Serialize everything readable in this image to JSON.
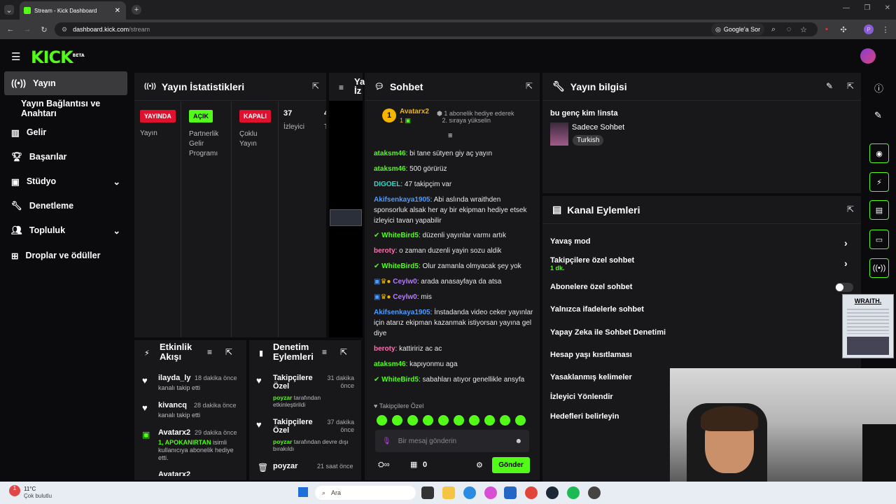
{
  "browser": {
    "tab_title": "Stream - Kick Dashboard",
    "url_domain": "dashboard.kick.com",
    "url_path": "/stream",
    "google_lens": "Google'a Sor"
  },
  "header": {
    "logo": "KICK",
    "logo_beta": "BETA"
  },
  "sidebar": {
    "items": [
      {
        "label": "Yayın",
        "icon": "broadcast-icon"
      },
      {
        "label": "Yayın Bağlantısı ve Anahtarı"
      },
      {
        "label": "Gelir",
        "icon": "chart-icon"
      },
      {
        "label": "Başarılar",
        "icon": "trophy-icon"
      },
      {
        "label": "Stüdyo",
        "icon": "studio-icon"
      },
      {
        "label": "Denetleme",
        "icon": "wrench-icon"
      },
      {
        "label": "Topluluk",
        "icon": "community-icon"
      },
      {
        "label": "Droplar ve ödüller",
        "icon": "drops-icon"
      }
    ]
  },
  "stats": {
    "title": "Yayın İstatistikleri",
    "cols": [
      {
        "badge": "YAYINDA",
        "label": "Yayın"
      },
      {
        "badge": "AÇIK",
        "label": "Partnerlik Gelir Programı"
      },
      {
        "badge": "KAPALI",
        "label": "Çoklu Yayın"
      },
      {
        "value": "37",
        "label": "İzleyici"
      },
      {
        "value": "4",
        "label": "T"
      }
    ]
  },
  "preview": {
    "title_a": "Ya",
    "title_b": "İz"
  },
  "chat": {
    "title": "Sohbet",
    "top_user": "Avatarx2",
    "top_rank": "1",
    "top_count": "1",
    "gift_line1": "1 abonelik hediye ederek",
    "gift_line2": "2. sıraya yükselin",
    "messages": [
      {
        "user": "ataksm46",
        "text": "bi tane sütyen giy aç yayın"
      },
      {
        "user": "ataksm46",
        "text": "500 görürüz"
      },
      {
        "user": "DIGOEL",
        "text": "47 takipçim var"
      },
      {
        "user": "Akifsenkaya1905",
        "text": "Abi aslında wraithden sponsorluk alsak her ay bir ekipman hediye etsek izleyici tavan yapabilir"
      },
      {
        "user": "WhiteBird5",
        "text": "düzenli yayınlar varmı artık"
      },
      {
        "user": "beroty",
        "text": "o zaman duzenli yayin sozu aldik"
      },
      {
        "user": "WhiteBird5",
        "text": "Olur zamanla olmyacak şey yok"
      },
      {
        "user": "Ceylw0",
        "text": "arada anasayfaya da atsa"
      },
      {
        "user": "Ceylw0",
        "text": "mis"
      },
      {
        "user": "Akifsenkaya1905",
        "text": "İnstadanda video ceker yayınlar için atarız ekipman kazanmak istiyorsan yayına gel diye"
      },
      {
        "user": "beroty",
        "text": "kattiririz ac ac"
      },
      {
        "user": "ataksm46",
        "text": "kapıyonmu aga"
      },
      {
        "user": "WhiteBird5",
        "text": "sabahları atıyor genellikle ansyfa"
      }
    ],
    "emote_label": "Takipçilere Özel",
    "input_placeholder": "Bir mesaj gönderin",
    "points": "0",
    "send": "Gönder"
  },
  "info": {
    "title": "Yayın bilgisi",
    "stream_title": "bu genç kim !insta",
    "category": "Sadece Sohbet",
    "language": "Turkish"
  },
  "actions": {
    "title": "Kanal Eylemleri",
    "items": [
      {
        "label": "Yavaş mod"
      },
      {
        "label": "Takipçilere özel sohbet",
        "sub": "1 dk."
      },
      {
        "label": "Abonelere özel sohbet"
      },
      {
        "label": "Yalnızca ifadelerle sohbet"
      },
      {
        "label": "Yapay Zeka ile Sohbet Denetimi"
      },
      {
        "label": "Hesap yaşı kısıtlaması"
      },
      {
        "label": "Yasaklanmış kelimeler"
      },
      {
        "label": "İzleyici Yönlendir"
      },
      {
        "label": "Hedefleri belirleyin"
      }
    ]
  },
  "activity": {
    "title_a": "Etkinlik",
    "title_b": "Akışı",
    "items": [
      {
        "user": "ilayda_ly",
        "time": "18 dakika önce",
        "desc": "kanalı takip etti"
      },
      {
        "user": "kivancq",
        "time": "28 dakika önce",
        "desc": "kanalı takip etti"
      },
      {
        "user": "Avatarx2",
        "time": "29 dakika önce",
        "desc_green": "1, APOKANIRTAN",
        "desc": " isimli kullanıcıya abonelik hediye etti."
      },
      {
        "user": "Avatarx2",
        "time": ""
      }
    ]
  },
  "mod": {
    "title_a": "Denetim",
    "title_b": "Eylemleri",
    "items": [
      {
        "title": "Takipçilere Özel",
        "time": "31 dakika önce",
        "by": "poyzar",
        "desc": "tarafından etkinleştirildi"
      },
      {
        "title": "Takipçilere Özel",
        "time": "37 dakika önce",
        "by": "poyzar",
        "desc": "tarafından devre dışı bırakıldı"
      },
      {
        "title": "poyzar",
        "time": "21 saat önce",
        "by": "",
        "desc": ""
      }
    ]
  },
  "ad": {
    "brand": "WRAITH."
  },
  "taskbar": {
    "temp": "11°C",
    "weather": "Çok bulutlu",
    "search": "Ara",
    "notif": "1"
  }
}
